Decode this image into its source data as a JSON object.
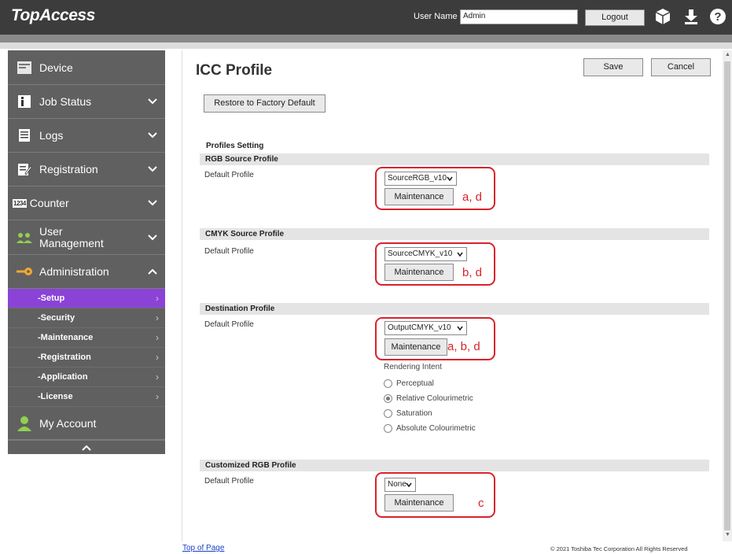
{
  "header": {
    "logo": "TopAccess",
    "user_name_label": "User Name",
    "user_name_value": "Admin",
    "logout_label": "Logout",
    "icons": [
      "box-icon",
      "download-icon",
      "help-icon"
    ]
  },
  "sidebar": {
    "items": [
      {
        "label": "Device",
        "icon": "device-icon"
      },
      {
        "label": "Job Status",
        "icon": "info-icon"
      },
      {
        "label": "Logs",
        "icon": "logs-icon"
      },
      {
        "label": "Registration",
        "icon": "registration-icon"
      },
      {
        "label": "Counter",
        "icon": "counter-icon",
        "icon_text": "1234"
      },
      {
        "label_line1": "User",
        "label_line2": "Management",
        "icon": "users-icon"
      },
      {
        "label": "Administration",
        "icon": "key-icon"
      }
    ],
    "admin_sub_items": [
      "-Setup",
      "-Security",
      "-Maintenance",
      "-Registration",
      "-Application",
      "-License"
    ],
    "my_account": "My Account"
  },
  "main": {
    "title": "ICC Profile",
    "save_label": "Save",
    "cancel_label": "Cancel",
    "restore_label": "Restore to Factory Default",
    "profiles_setting": "Profiles Setting",
    "sections": [
      {
        "title": "RGB Source Profile",
        "field_label": "Default Profile",
        "selected": "SourceRGB_v10",
        "maintenance_label": "Maintenance",
        "annotation": "a, d"
      },
      {
        "title": "CMYK Source Profile",
        "field_label": "Default Profile",
        "selected": "SourceCMYK_v10",
        "maintenance_label": "Maintenance",
        "annotation": "b, d"
      },
      {
        "title": "Destination Profile",
        "field_label": "Default Profile",
        "selected": "OutputCMYK_v10",
        "maintenance_label": "Maintenance",
        "annotation": "a, b, d"
      },
      {
        "title": "Customized RGB Profile",
        "field_label": "Default Profile",
        "selected": "None",
        "maintenance_label": "Maintenance",
        "annotation": "c"
      }
    ],
    "rendering_intent": {
      "label": "Rendering Intent",
      "options": [
        "Perceptual",
        "Relative Colourimetric",
        "Saturation",
        "Absolute Colourimetric"
      ],
      "selected": "Relative Colourimetric"
    }
  },
  "footer": {
    "top_of_page": "Top of Page",
    "copyright": "© 2021 Toshiba Tec Corporation All Rights Reserved"
  },
  "colors": {
    "header_bg": "#3c3c3c",
    "sidebar_bg": "#606060",
    "active_sub_item": "#8a43d6",
    "annotation_red": "#d9222a"
  }
}
